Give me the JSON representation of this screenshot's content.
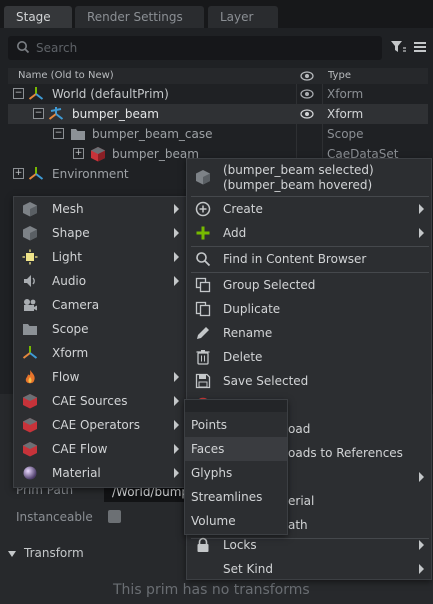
{
  "tabs": [
    {
      "label": "Stage",
      "active": true
    },
    {
      "label": "Render Settings",
      "active": false
    },
    {
      "label": "Layer",
      "active": false
    }
  ],
  "search": {
    "placeholder": "Search"
  },
  "stage": {
    "columns": {
      "name": "Name (Old to New)",
      "type": "Type"
    },
    "rows": [
      {
        "label": "World (defaultPrim)",
        "type": "Xform",
        "icon": "xform-icon",
        "expander": "−"
      },
      {
        "label": "bumper_beam",
        "type": "Xform",
        "icon": "xform-selected-icon",
        "expander": "−"
      },
      {
        "label": "bumper_beam_case",
        "type": "Scope",
        "icon": "folder-icon",
        "expander": "−"
      },
      {
        "label": "bumper_beam",
        "type": "CaeDataSet",
        "icon": "cae-dataset-icon",
        "expander": "+"
      },
      {
        "label": "Environment",
        "type": "",
        "icon": "xform-icon",
        "expander": "+"
      }
    ]
  },
  "properties": {
    "prim_path_label": "Prim Path",
    "prim_path_value": "/World/bumper_beam",
    "instanceable_label": "Instanceable",
    "transform_header": "Transform",
    "no_transforms": "This prim has no transforms"
  },
  "create_menu": {
    "items": [
      {
        "label": "Mesh",
        "icon": "cube-icon",
        "submenu": true
      },
      {
        "label": "Shape",
        "icon": "cube-icon",
        "submenu": true
      },
      {
        "label": "Light",
        "icon": "light-icon",
        "submenu": true
      },
      {
        "label": "Audio",
        "icon": "audio-icon",
        "submenu": true
      },
      {
        "label": "Camera",
        "icon": "camera-icon",
        "submenu": false
      },
      {
        "label": "Scope",
        "icon": "folder-icon",
        "submenu": false
      },
      {
        "label": "Xform",
        "icon": "xform-icon",
        "submenu": false
      },
      {
        "label": "Flow",
        "icon": "flow-icon",
        "submenu": true
      },
      {
        "label": "CAE Sources",
        "icon": "cae-icon",
        "submenu": true
      },
      {
        "label": "CAE Operators",
        "icon": "cae-icon",
        "submenu": true
      },
      {
        "label": "CAE Flow",
        "icon": "cae-icon",
        "submenu": true
      },
      {
        "label": "Material",
        "icon": "material-icon",
        "submenu": true
      }
    ]
  },
  "context_menu": {
    "header_line1": "(bumper_beam selected)",
    "header_line2": "(bumper_beam hovered)",
    "items": [
      {
        "label": "Create",
        "icon": "plus-circle-icon",
        "submenu": true
      },
      {
        "label": "Add",
        "icon": "plus-icon",
        "submenu": true
      },
      {
        "label": "Find in Content Browser",
        "icon": "search-icon",
        "submenu": false
      },
      {
        "label": "Group Selected",
        "icon": "group-icon",
        "submenu": false
      },
      {
        "label": "Duplicate",
        "icon": "duplicate-icon",
        "submenu": false
      },
      {
        "label": "Rename",
        "icon": "pencil-icon",
        "submenu": false
      },
      {
        "label": "Delete",
        "icon": "trash-icon",
        "submenu": false
      },
      {
        "label": "Save Selected",
        "icon": "save-icon",
        "submenu": false
      },
      {
        "label": "Deactivate",
        "icon": "deactivate-icon",
        "submenu": false
      },
      {
        "label": "Unload",
        "icon": "",
        "submenu": false
      },
      {
        "label": "Convert Payloads to References",
        "icon": "",
        "submenu": false
      },
      {
        "label": "",
        "icon": "",
        "submenu": true
      },
      {
        "label": "Copy Material",
        "icon": "",
        "submenu": false
      },
      {
        "label": "Copy Path",
        "icon": "",
        "submenu": false
      },
      {
        "label": "Locks",
        "icon": "lock-icon",
        "submenu": true
      },
      {
        "label": "Set Kind",
        "icon": "",
        "submenu": true
      }
    ]
  },
  "visible_fragments": {
    "deactivate": "De",
    "unload": "oad",
    "convert": "oads to References",
    "copy_material": "erial",
    "copy_path": "ath"
  },
  "sub_menu": {
    "items": [
      {
        "label": "Points"
      },
      {
        "label": "Faces",
        "hovered": true
      },
      {
        "label": "Glyphs"
      },
      {
        "label": "Streamlines"
      },
      {
        "label": "Volume"
      }
    ]
  },
  "colors": {
    "background": "#1f2124",
    "accent_green": "#76b900",
    "xform_blue": "#3f9bd5",
    "xform_orange": "#e4873d"
  }
}
